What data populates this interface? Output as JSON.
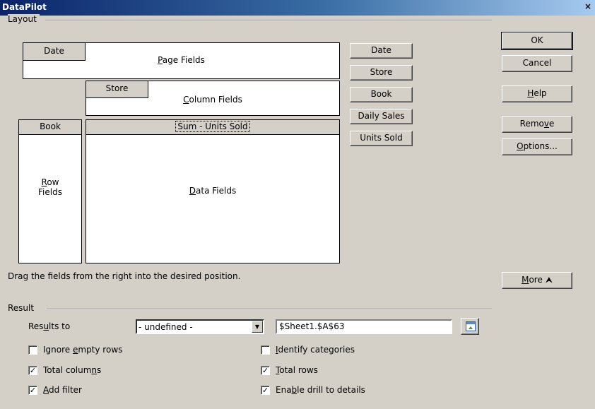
{
  "window": {
    "title": "DataPilot",
    "close_glyph": "×"
  },
  "layout": {
    "group_label": "Layout",
    "page_fields": {
      "label_prefix": "",
      "label_accel": "P",
      "label_rest": "age Fields",
      "field": "Date"
    },
    "column_fields": {
      "label_accel": "C",
      "label_rest": "olumn Fields",
      "field": "Store"
    },
    "row_fields": {
      "label_accel": "R",
      "label_rest": "ow",
      "label_line2": "Fields",
      "field": "Book"
    },
    "data_fields": {
      "label_accel": "D",
      "label_rest": "ata Fields",
      "field": "Sum - Units Sold"
    },
    "available_fields": [
      "Date",
      "Store",
      "Book",
      "Daily Sales",
      "Units Sold"
    ],
    "hint": "Drag the fields from the right into the desired position."
  },
  "buttons": {
    "ok": "OK",
    "cancel": "Cancel",
    "help_accel": "H",
    "help_rest": "elp",
    "remove_pre": "Remo",
    "remove_accel": "v",
    "remove_post": "e",
    "options_accel": "O",
    "options_rest": "ptions...",
    "more_accel": "M",
    "more_rest": "ore",
    "more_glyph": "⮝"
  },
  "result": {
    "group_label": "Result",
    "results_to_pre": "Res",
    "results_to_accel": "u",
    "results_to_post": "lts to",
    "destination_select": "- undefined -",
    "destination_input": "$Sheet1.$A$63",
    "checkboxes": {
      "ignore_empty_rows": {
        "pre": "Ignore ",
        "accel": "e",
        "post": "mpty rows",
        "checked": false
      },
      "identify_categories": {
        "pre": "",
        "accel": "I",
        "post": "dentify categories",
        "checked": false
      },
      "total_columns": {
        "pre": "Total colum",
        "accel": "n",
        "post": "s",
        "checked": true
      },
      "total_rows": {
        "pre": "",
        "accel": "T",
        "post": "otal rows",
        "checked": true
      },
      "add_filter": {
        "pre": "",
        "accel": "A",
        "post": "dd filter",
        "checked": true
      },
      "enable_drill": {
        "pre": "Ena",
        "accel": "b",
        "post": "le drill to details",
        "checked": true
      }
    }
  }
}
